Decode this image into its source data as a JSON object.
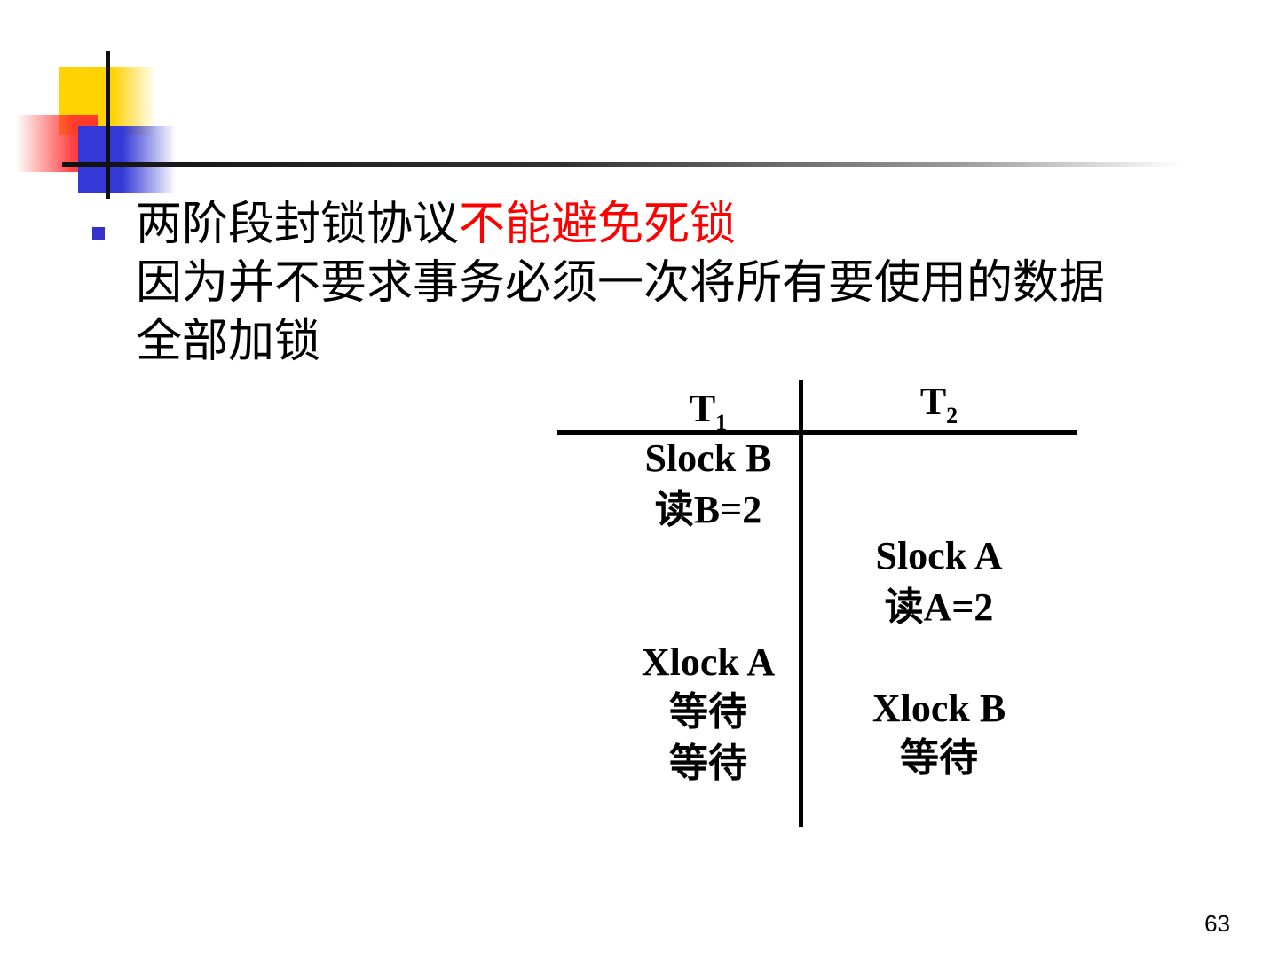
{
  "slide": {
    "bullet": {
      "line1_black": "两阶段封锁协议",
      "line1_red": "不能避免死锁",
      "line2": "因为并不要求事务必须一次将所有要使用的数据",
      "line3": "全部加锁"
    },
    "schedule": {
      "t1_header": "T",
      "t1_sub": "1",
      "t2_header": "T",
      "t2_sub": "2",
      "t1_ops": [
        "Slock B",
        "读B=2",
        "Xlock A",
        "等待",
        "等待"
      ],
      "t2_ops": [
        "Slock A",
        "读A=2",
        "Xlock B",
        "等待"
      ]
    },
    "page_number": "63"
  },
  "colors": {
    "accent_red": "#ff0000",
    "bullet_blue": "#3333cc",
    "logo_yellow": "#ffd200",
    "logo_blue": "#3338d6"
  }
}
